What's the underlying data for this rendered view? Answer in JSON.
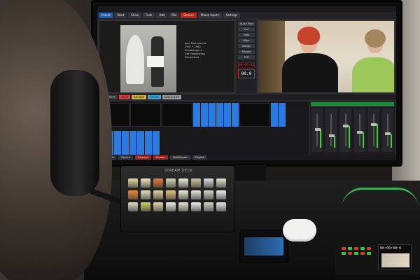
{
  "app": {
    "tabs": [
      "Preset",
      "Start",
      "Show",
      "Fade",
      "Add",
      "Mix",
      "Stream",
      "Phone Inputs",
      "Settings"
    ],
    "active_tab_index": 0,
    "stream_tab_index": 6
  },
  "preview": {
    "caption_lines": [
      "Joan Fontcuberta",
      "1957 • 1983",
      "Schrödinger's",
      "Der Fotokosmos",
      "Documents"
    ]
  },
  "controls": {
    "buttons": [
      "Quick Play",
      "Cut",
      "Fade",
      "Wipe",
      "Merge",
      "Stinger",
      "FTB"
    ],
    "countdown": "00:09:42",
    "value": "00.0"
  },
  "buses": [
    {
      "label": "ALL INPUTS",
      "color": "#3a3a40"
    },
    {
      "label": "CAMS",
      "color": "#d94040"
    },
    {
      "label": "BROADS",
      "color": "#d0b040"
    },
    {
      "label": "SHOTS",
      "color": "#40a0d8"
    },
    {
      "label": "AUDIOCLIPS",
      "color": "#9a9aa0"
    }
  ],
  "footer": {
    "buttons": [
      "Add Input",
      "Record",
      "External",
      "Stream",
      "MultiCorder",
      "Playlist"
    ],
    "red_indices": [
      2,
      3
    ]
  },
  "audio": {
    "faders": [
      {
        "level": 0.55
      },
      {
        "level": 0.35
      },
      {
        "level": 0.65
      },
      {
        "level": 0.45
      },
      {
        "level": 0.7
      },
      {
        "level": 0.4
      }
    ]
  },
  "stream_deck": {
    "brand": "STREAM DECK",
    "key_colors": [
      "#e9d9a0",
      "#f0e6c0",
      "#e87a3a",
      "#d8d8b0",
      "#f0f0e0",
      "#d0c9a0",
      "#e0e0e0",
      "#e8e8d0",
      "#f08a3a",
      "#e4e4c8",
      "#e8d4a0",
      "#e4c880",
      "#f0f0d8",
      "#e8e8e0",
      "#d8d8c8",
      "#f0f0f0",
      "#e0e0c8",
      "#c8d860",
      "#e4d8a8",
      "#f0f0e8",
      "#e8e8d8",
      "#f0f0f0",
      "#d8d8c0",
      "#e8e8e8"
    ]
  },
  "recorder": {
    "time": "00:00:00:0"
  }
}
